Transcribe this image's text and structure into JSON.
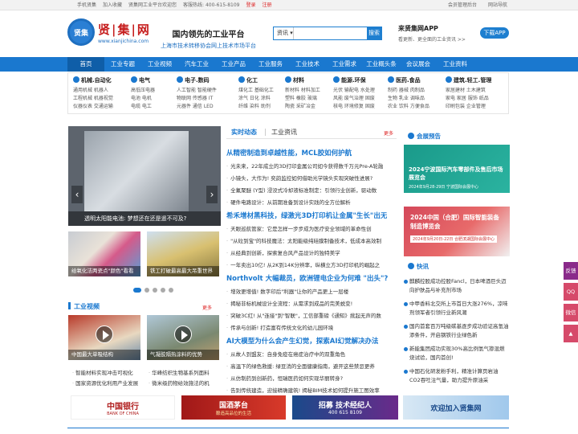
{
  "topbar": {
    "mobile": "手机贤集",
    "favorite": "加入收藏",
    "welcome": "贤集网工业平台欢迎您",
    "hotline": "客服热线: 400-615-8109",
    "login": "登录",
    "register": "注册",
    "member": "会员管理后台",
    "site_nav": "网站导航"
  },
  "logo": {
    "cn": "贤|集|网",
    "en": "www.xianjichina.com",
    "mark": "贤集"
  },
  "slogan": {
    "line1": "国内领先的工业平台",
    "line2": "上海市技术转移协会网上技术市场平台"
  },
  "search": {
    "category": "资讯",
    "button": "搜索",
    "placeholder": ""
  },
  "app": {
    "title": "来贤集网APP",
    "subtitle": "看更新、更全面的工业资讯 >>",
    "download": "下载APP"
  },
  "nav": [
    "首页",
    "工业专题",
    "工业视频",
    "汽车工业",
    "工业产品",
    "工业服务",
    "工业技术",
    "工业需求",
    "工业概头条",
    "会议展会",
    "工业资料"
  ],
  "categories": [
    {
      "title": "机械.自动化",
      "rows": [
        "通用机械 机器人",
        "工程机械 机器视觉",
        "仪器仪表 交通运输"
      ]
    },
    {
      "title": "电气",
      "rows": [
        "高低压电器",
        "电池 电机",
        "电缆 电工"
      ]
    },
    {
      "title": "电子.数码",
      "rows": [
        "人工智能 智能硬件",
        "物联网 传感器 IT",
        "元器件 通信 LED"
      ]
    },
    {
      "title": "化工",
      "rows": [
        "煤化工 基础化工",
        "涂气 日化 涂料",
        "纤维 染料 助剂"
      ]
    },
    {
      "title": "材料",
      "rows": [
        "新材料 材料加工",
        "塑料 橡胶 玻璃",
        "陶瓷 采矿冶金"
      ]
    },
    {
      "title": "能源.环保",
      "rows": [
        "光伏 输配电 水处理",
        "风能 废气治理 固废",
        "核电 环境修复 固废"
      ]
    },
    {
      "title": "医药.食品",
      "rows": [
        "制药 器械 肉制品",
        "生物 乳业 调味品",
        "农业 饮料 方便食品"
      ]
    },
    {
      "title": "建筑.轻工.管理",
      "rows": [
        "家居建材 土木建筑",
        "家电 家居 服饰 纸品",
        "印刷包装 企业管理"
      ]
    }
  ],
  "slider": {
    "caption": "透明太阳能电池: 梦想还在还是遥不可及?"
  },
  "pics": [
    {
      "caption": "给氧化洁两瓷点\"颜色\"看看"
    },
    {
      "caption": "铁工打破最高最大吊重世界"
    }
  ],
  "video_section": {
    "title": "工业视频",
    "more": "更多"
  },
  "videos": [
    {
      "caption": "中国最大单吸结构"
    },
    {
      "caption": "气凝胶隔热涂料的优势"
    }
  ],
  "video_list": [
    [
      "智能材料实现冲击可视化",
      "华峰纺织生物基系列面料"
    ],
    [
      "国家资源优化利用产业发展",
      "微米级药物给效施法的机"
    ]
  ],
  "news": {
    "tab1": "实时动态",
    "tab2": "工业资讯",
    "more": "更多",
    "groups": [
      {
        "headline": "从精密制造到卓越性能，MCL胶如何护航",
        "items": [
          "光未来，22年成立的3D打印金属公司如今获得数千万元Pre-A轮融",
          "小镜头，大作为! 奕韵监控如何借助光学镜头实现突破性进展?",
          "全氟聚醚 (Y型) 浸没式冷却液标准制定：引领行业创新，驱动数",
          "硬件电路设计：从前期准备到设计实践的全方位解析"
        ]
      },
      {
        "headline": "希禾增材黑科技，绿激光3D打印机让金属\"生长\"出无",
        "items": [
          "天眼巡航管家：它是怎样一步步成为医疗安全领域的革命性创",
          "\"从砬到宝\"的科技魔法：太阳能级纯硅膜制备技术，低成本高效制",
          "从经典到创新，探索复合风产品设计的独特美学",
          "一年卖出10亿! 从2K到14K分辨率，纵横立方3D打印机的崛起之"
        ]
      },
      {
        "headline": "Northvolt 大幅裁员，欧洲锂电企业为何难 \"出头\"?",
        "items": [
          "增效更增值! 数字印后\"利器\"让你的产品更上一层楼",
          "揭秘非标机械设计全流程：从需求到成品的完美蜕变!",
          "突破3C红! 从\"连接\"到\"智联\"，工信部重磅《通知》掀起无声的数",
          "传承与创新! 打造富有传统文化的幼儿园环境"
        ]
      },
      {
        "headline": "AI大模型为什么会产生幻觉，探索AI幻觉解决办法",
        "items": [
          "从故人到盟友：自身免疫在癌症治疗中的双重角色",
          "高温下的绿色救援: 绿豆消的全面健康指南，避开这些禁忌更养",
          "从仿制药到创新药，恒瑞医药如何实现华丽转身?",
          "告别传统建造，迎接精确建筑! 揭秘BIM技术如何提升施工图效率"
        ]
      }
    ]
  },
  "expo": {
    "title": "会展预告",
    "banner1": "2024宁波国际汽车零部件及售后市场展览会",
    "banner1_date": "2024年9月28-29日  宁波国际会展中心",
    "banner2": "2024中国（合肥）国际智能装备制造博览会",
    "banner2_date": "2024年9月20日-22日  合肥滨湖国际会展中心"
  },
  "flash": {
    "title": "快讯",
    "items": [
      "麒麟控股成功控股Fancl，日本啤酒巨头迈向护肤品与补充剂市场",
      "中甲香料北交所上市首日大涨276%，凉味剂领军者引领行业新风潮",
      "国内首套百万吨级碳基逐步成功验证高氢油添条件，开启钢铁行业绿色新",
      "新能集团成功实现30%高比例氢气掺混燃烧试验，国内首创!",
      "中国石化研发粉手利，精准计算页岩油CO2吞吐注气量，助力提升原油采"
    ]
  },
  "banners": [
    {
      "text": "中国银行",
      "sub": "BANK OF CHINA"
    },
    {
      "text": "国酒茅台",
      "sub": "酿造高品位的生活"
    },
    {
      "text": "招募 技术经纪人",
      "sub": "400 615 8109"
    },
    {
      "text": "欢迎加入贤集网",
      "sub": ""
    }
  ],
  "side": [
    "反馈",
    "QQ",
    "微信",
    ""
  ]
}
